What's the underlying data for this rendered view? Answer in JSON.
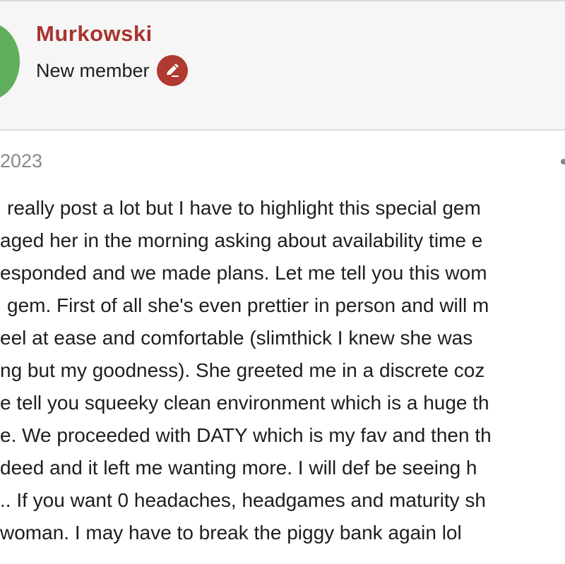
{
  "author": {
    "username": "Murkowski",
    "role": "New member",
    "badge_icon": "pencil-edit-icon",
    "badge_color": "#b03a30",
    "username_color": "#a8332f",
    "avatar_color": "#5fae5b"
  },
  "post": {
    "date": "2023",
    "body_lines": [
      " really post a lot but I have to highlight this special gem",
      "aged her in the morning asking about availability time e",
      "esponded and we made plans. Let me tell you this wom",
      " gem. First of all she's even prettier in person and will m",
      "eel at ease and comfortable (slimthick I knew she was",
      "ng but my goodness). She greeted me in a discrete coz",
      "e tell you squeeky clean environment which is a huge th",
      "e. We proceeded with DATY which is my fav and then th",
      "deed and it left me wanting more. I will def be seeing h",
      ".. If you want 0 headaches, headgames and maturity sh",
      "woman. I may have to break the piggy bank again lol"
    ]
  }
}
